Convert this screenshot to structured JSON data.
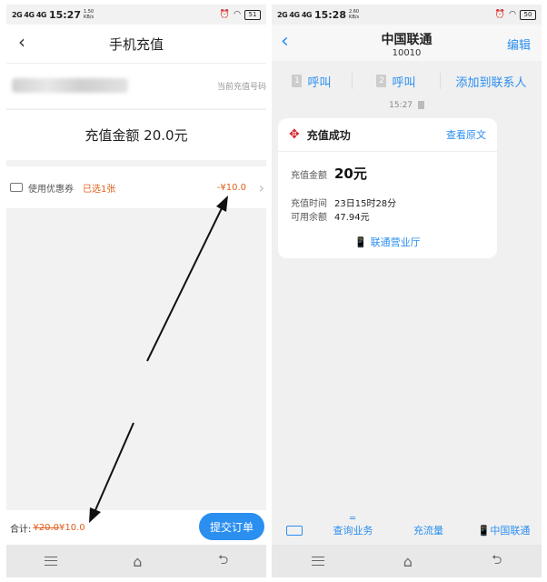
{
  "left": {
    "status": {
      "signal": "2G 4G 4G",
      "time": "15:27",
      "speed_value": "1.50",
      "speed_unit": "KB/s",
      "battery": "51"
    },
    "header": {
      "title": "手机充值"
    },
    "phone_row": {
      "hint": "当前充值号码"
    },
    "amount": {
      "text": "充值金额 20.0元"
    },
    "coupon": {
      "label": "使用优惠券",
      "selected": "已选1张",
      "discount": "-¥10.0"
    },
    "bottom": {
      "total_label": "合计:",
      "original_price": "¥20.0",
      "final_price": "¥10.0",
      "submit_label": "提交订单"
    }
  },
  "right": {
    "status": {
      "signal": "2G 4G 4G",
      "time": "15:28",
      "speed_value": "2.60",
      "speed_unit": "KB/s",
      "battery": "50"
    },
    "header": {
      "contact": "中国联通",
      "number": "10010",
      "edit": "编辑"
    },
    "actions": [
      {
        "sim": "1",
        "label": "呼叫"
      },
      {
        "sim": "2",
        "label": "呼叫"
      },
      {
        "label": "添加到联系人"
      }
    ],
    "message_time": "15:27",
    "card": {
      "title": "充值成功",
      "view_original": "查看原文",
      "amount_label": "充值金额",
      "amount_value": "20元",
      "time_label": "充值时间",
      "time_value": "23日15时28分",
      "balance_label": "可用余额",
      "balance_value": "47.94元",
      "hall_link": "联通营业厅"
    },
    "bottom_menu": [
      "查询业务",
      "充流量",
      "中国联通"
    ]
  },
  "colors": {
    "accent_blue": "#2b8ff0",
    "price_orange": "#e0601e",
    "unicom_red": "#d8232a"
  }
}
